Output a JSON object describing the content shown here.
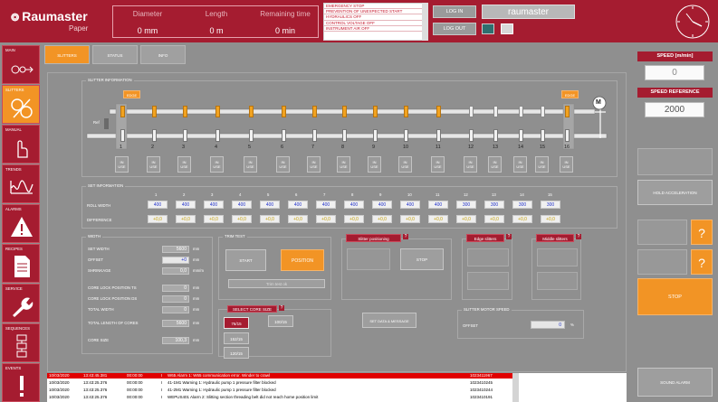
{
  "header": {
    "logo": "Raumaster",
    "logo_sub": "Paper",
    "diameter_label": "Diameter",
    "diameter_value": "0 mm",
    "length_label": "Length",
    "length_value": "0 m",
    "remaining_label": "Remaining time",
    "remaining_value": "0 min",
    "alarms": [
      "EMERGENCY STOP",
      "PREVENTION OF UNEXPECTED START",
      "HYDRAULICS OFF",
      "CONTROL VOLTAGE OFF",
      "INSTRUMENT AIR OFF"
    ],
    "login": "LOG IN",
    "logout": "LOG OUT",
    "user": "raumaster"
  },
  "sidebar": [
    {
      "label": "MAIN",
      "icon": "main-icon"
    },
    {
      "label": "SLITTERS",
      "icon": "slitters-icon",
      "active": true
    },
    {
      "label": "MANUAL",
      "icon": "hand-icon"
    },
    {
      "label": "TRENDS",
      "icon": "trend-icon"
    },
    {
      "label": "ALARMS",
      "icon": "warning-icon"
    },
    {
      "label": "RECIPES",
      "icon": "document-icon"
    },
    {
      "label": "SERVICE",
      "icon": "wrench-icon"
    },
    {
      "label": "SEQUENCES",
      "icon": "sequence-icon"
    },
    {
      "label": "EVENTS",
      "icon": "exclamation-icon"
    }
  ],
  "tabs": [
    "SLITTERS",
    "STATUS",
    "INFO"
  ],
  "slitter_info": {
    "title": "SLITTER INFORMATION",
    "edge_left": "EDGE",
    "edge_right": "EDGE",
    "motor": "M",
    "ref": "Ref",
    "numbers": [
      "1",
      "2",
      "3",
      "4",
      "5",
      "6",
      "7",
      "8",
      "9",
      "10",
      "11",
      "12",
      "13",
      "14",
      "15",
      "16"
    ],
    "in_use": "IN USE"
  },
  "set_info": {
    "title": "SET INFORMATION",
    "cols": [
      "1",
      "2",
      "3",
      "4",
      "5",
      "6",
      "7",
      "8",
      "9",
      "10",
      "11",
      "12",
      "13",
      "14",
      "15"
    ],
    "roll_width_label": "ROLL WIDTH",
    "roll_width": [
      "400",
      "400",
      "400",
      "400",
      "400",
      "400",
      "400",
      "400",
      "400",
      "400",
      "400",
      "300",
      "300",
      "300",
      "300"
    ],
    "difference_label": "DIFFERENCE",
    "difference": [
      "+0,0",
      "+0,0",
      "+0,0",
      "+0,0",
      "+0,0",
      "+0,0",
      "+0,0",
      "+0,0",
      "+0,0",
      "+0,0",
      "+0,0",
      "+0,0",
      "+0,0",
      "+0,0",
      "+0,0"
    ]
  },
  "width": {
    "title": "WIDTH",
    "set_width_label": "SET WIDTH",
    "set_width": "5600",
    "set_width_unit": "mm",
    "offset_label": "OFFSET",
    "offset": "+0",
    "offset_unit": "mm",
    "shrinkage_label": "SHRINKAGE",
    "shrinkage": "0,0",
    "shrinkage_unit": "mm/m",
    "core_ts_label": "CORE LOCK POSITION TS",
    "core_ts": "0",
    "core_ts_unit": "mm",
    "core_ds_label": "CORE LOCK POSITION DS",
    "core_ds": "0",
    "core_ds_unit": "mm",
    "total_width_label": "TOTAL WIDTH",
    "total_width": "0",
    "total_width_unit": "mm",
    "total_cores_label": "TOTAL LENGTH OF CORES",
    "total_cores": "5600",
    "total_cores_unit": "mm",
    "core_size_label": "CORE SIZE",
    "core_size": "100,3",
    "core_size_unit": "mm"
  },
  "trim_test": {
    "title": "TRIM TEST",
    "start": "START",
    "position": "POSITION",
    "status": "Trim test ok"
  },
  "core_size": {
    "title": "SELECT CORE SIZE",
    "options": [
      "76/15",
      "100/15",
      "152/15",
      "120/15"
    ]
  },
  "slitter_positioning": {
    "title": "Slitter positioning",
    "stop": "STOP"
  },
  "edge_slitters": {
    "title": "Edge slitters"
  },
  "middle_slitters": {
    "title": "Middle slitters"
  },
  "set_data": "SET DATA & MESSAGE",
  "motor_speed": {
    "title": "SLITTER MOTOR SPEED",
    "offset_label": "OFFSET",
    "offset": "0",
    "unit": "%"
  },
  "right_panel": {
    "speed_label": "SPEED [m/min]",
    "speed": "0",
    "speed_ref_label": "SPEED REFERENCE",
    "speed_ref": "2000",
    "hold_acceleration": "HOLD ACCELERATION",
    "stop": "STOP",
    "sound_alarm": "SOUND ALARM",
    "question": "?"
  },
  "alarm_rows": [
    {
      "date": "10/03/2020",
      "time": "13:43:45.381",
      "dur": "00:00:00",
      "flag": "I",
      "text": "W65 Alarm 1: W65 communication error. Winder to crawl",
      "code": "1023411967"
    },
    {
      "date": "10/03/2020",
      "time": "13:43:25.376",
      "dur": "00:00:00",
      "flag": "I",
      "text": "41-1M1 Warning 1: Hydraulic pump 1 pressure filter blocked",
      "code": "1023410245"
    },
    {
      "date": "10/03/2020",
      "time": "13:43:25.376",
      "dur": "00:00:00",
      "flag": "I",
      "text": "41-2M1 Warning 1: Hydraulic pump 1 pressure filter blocked",
      "code": "1023410244"
    },
    {
      "date": "10/03/2020",
      "time": "13:43:25.376",
      "dur": "00:00:00",
      "flag": "I",
      "text": "WEPUS401 Alarm 2: Slitting section threading belt did not reach home position limit",
      "code": "1023410191"
    }
  ]
}
